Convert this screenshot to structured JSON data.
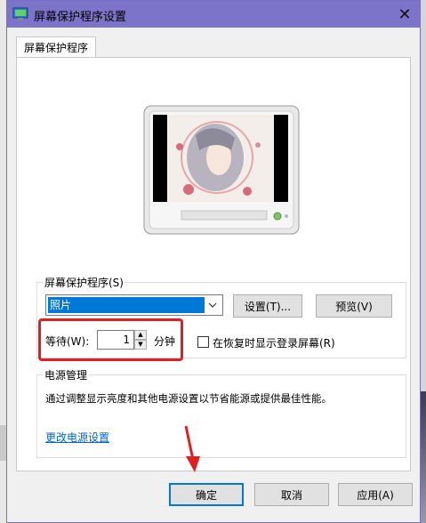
{
  "window": {
    "title": "屏幕保护程序设置",
    "close_glyph": "✕"
  },
  "tab": {
    "label": "屏幕保护程序"
  },
  "screensaver_group": {
    "label": "屏幕保护程序(S)",
    "selected": "照片",
    "settings_button": "设置(T)...",
    "preview_button": "预览(V)",
    "wait_label": "等待(W):",
    "wait_value": "1",
    "wait_unit": "分钟",
    "resume_label": "在恢复时显示登录屏幕(R)",
    "resume_checked": false
  },
  "power_group": {
    "label": "电源管理",
    "description": "通过调整显示亮度和其他电源设置以节省能源或提供最佳性能。",
    "link": "更改电源设置"
  },
  "buttons": {
    "ok": "确定",
    "cancel": "取消",
    "apply": "应用(A)"
  },
  "colors": {
    "titlebar": "#7b74c8",
    "highlight": "#e02020",
    "link": "#0066cc",
    "selection": "#0078d7"
  }
}
